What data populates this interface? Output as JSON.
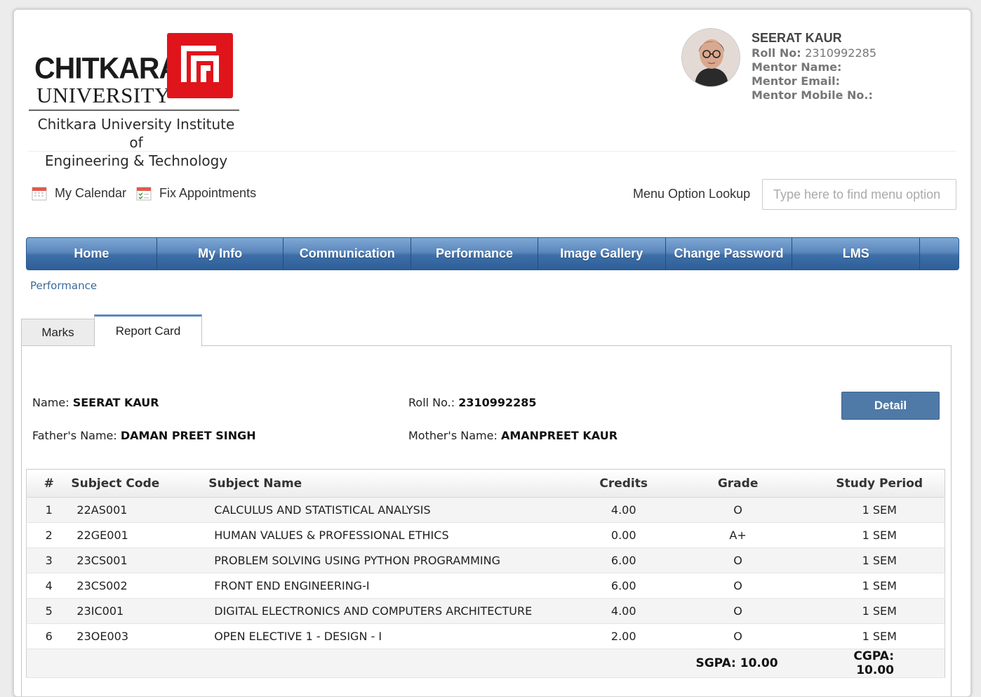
{
  "logo": {
    "word1": "CHITKARA",
    "word2": "UNIVERSITY",
    "subtitle_line1": "Chitkara University Institute of",
    "subtitle_line2": "Engineering & Technology",
    "brand_color": "#e0141b"
  },
  "profile": {
    "name": "SEERAT KAUR",
    "roll_label": "Roll No:",
    "roll_value": "2310992285",
    "mentor_name_label": "Mentor Name:",
    "mentor_email_label": "Mentor Email:",
    "mentor_mobile_label": "Mentor Mobile No.:"
  },
  "quick_links": {
    "calendar": "My Calendar",
    "appointments": "Fix Appointments"
  },
  "lookup": {
    "label": "Menu Option Lookup",
    "placeholder": "Type here to find menu option"
  },
  "nav": {
    "items": [
      "Home",
      "My Info",
      "Communication",
      "Performance",
      "Image Gallery",
      "Change Password",
      "LMS"
    ],
    "accent_color": "#3e6ea6"
  },
  "breadcrumb": "Performance",
  "tabs": {
    "marks": "Marks",
    "report_card": "Report Card",
    "active": "Report Card"
  },
  "student": {
    "name_label": "Name:",
    "name": "SEERAT KAUR",
    "roll_label": "Roll No.:",
    "roll": "2310992285",
    "father_label": "Father's Name:",
    "father": "DAMAN PREET SINGH",
    "mother_label": "Mother's Name:",
    "mother": "AMANPREET KAUR",
    "detail_button": "Detail"
  },
  "table": {
    "headers": [
      "#",
      "Subject Code",
      "Subject Name",
      "Credits",
      "Grade",
      "Study Period"
    ],
    "rows": [
      [
        "1",
        "22AS001",
        "CALCULUS AND STATISTICAL ANALYSIS",
        "4.00",
        "O",
        "1 SEM"
      ],
      [
        "2",
        "22GE001",
        "HUMAN VALUES & PROFESSIONAL ETHICS",
        "0.00",
        "A+",
        "1 SEM"
      ],
      [
        "3",
        "23CS001",
        "PROBLEM SOLVING USING PYTHON PROGRAMMING",
        "6.00",
        "O",
        "1 SEM"
      ],
      [
        "4",
        "23CS002",
        "FRONT END ENGINEERING-I",
        "6.00",
        "O",
        "1 SEM"
      ],
      [
        "5",
        "23IC001",
        "DIGITAL ELECTRONICS AND COMPUTERS ARCHITECTURE",
        "4.00",
        "O",
        "1 SEM"
      ],
      [
        "6",
        "23OE003",
        "OPEN ELECTIVE 1 - DESIGN - I",
        "2.00",
        "O",
        "1 SEM"
      ]
    ],
    "sgpa": "SGPA: 10.00",
    "cgpa": "CGPA: 10.00"
  }
}
